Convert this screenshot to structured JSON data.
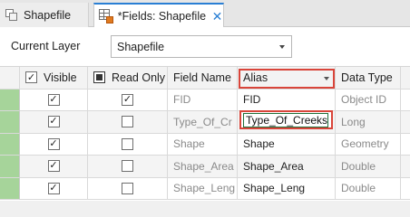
{
  "tabs": [
    {
      "label": "Shapefile",
      "icon": "layer-icon",
      "active": false
    },
    {
      "label": "*Fields: Shapefile",
      "icon": "fields-table-icon",
      "active": true,
      "close": "✕"
    }
  ],
  "current_layer": {
    "label": "Current Layer",
    "value": "Shapefile"
  },
  "columns": {
    "visible": "Visible",
    "read_only": "Read Only",
    "field_name": "Field Name",
    "alias": "Alias",
    "data_type": "Data Type"
  },
  "rows": [
    {
      "visible": true,
      "read_only": true,
      "field_name": "FID",
      "alias": "FID",
      "data_type": "Object ID"
    },
    {
      "visible": true,
      "read_only": false,
      "field_name": "Type_Of_Cr",
      "alias": "Type_Of_Creeks",
      "data_type": "Long"
    },
    {
      "visible": true,
      "read_only": false,
      "field_name": "Shape",
      "alias": "Shape",
      "data_type": "Geometry"
    },
    {
      "visible": true,
      "read_only": false,
      "field_name": "Shape_Area",
      "alias": "Shape_Area",
      "data_type": "Double"
    },
    {
      "visible": true,
      "read_only": false,
      "field_name": "Shape_Leng",
      "alias": "Shape_Leng",
      "data_type": "Double"
    }
  ],
  "colors": {
    "accent": "#2a7fd4",
    "highlight_border": "#d9453a",
    "row_selector": "#a6d49a"
  }
}
